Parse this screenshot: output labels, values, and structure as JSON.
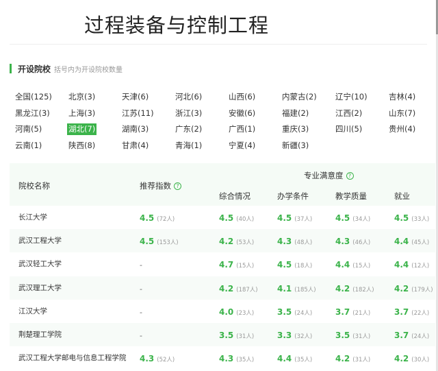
{
  "page": {
    "title": "过程装备与控制工程"
  },
  "section": {
    "title": "开设院校",
    "subtitle": "括号内为开设院校数量"
  },
  "regions": [
    {
      "label": "全国(125)",
      "active": false
    },
    {
      "label": "北京(3)",
      "active": false
    },
    {
      "label": "天津(6)",
      "active": false
    },
    {
      "label": "河北(6)",
      "active": false
    },
    {
      "label": "山西(6)",
      "active": false
    },
    {
      "label": "内蒙古(2)",
      "active": false
    },
    {
      "label": "辽宁(10)",
      "active": false
    },
    {
      "label": "吉林(4)",
      "active": false
    },
    {
      "label": "黑龙江(3)",
      "active": false
    },
    {
      "label": "上海(3)",
      "active": false
    },
    {
      "label": "江苏(11)",
      "active": false
    },
    {
      "label": "浙江(3)",
      "active": false
    },
    {
      "label": "安徽(6)",
      "active": false
    },
    {
      "label": "福建(2)",
      "active": false
    },
    {
      "label": "江西(2)",
      "active": false
    },
    {
      "label": "山东(7)",
      "active": false
    },
    {
      "label": "河南(5)",
      "active": false
    },
    {
      "label": "湖北(7)",
      "active": true
    },
    {
      "label": "湖南(3)",
      "active": false
    },
    {
      "label": "广东(2)",
      "active": false
    },
    {
      "label": "广西(1)",
      "active": false
    },
    {
      "label": "重庆(3)",
      "active": false
    },
    {
      "label": "四川(5)",
      "active": false
    },
    {
      "label": "贵州(4)",
      "active": false
    },
    {
      "label": "云南(1)",
      "active": false
    },
    {
      "label": "陕西(8)",
      "active": false
    },
    {
      "label": "甘肃(4)",
      "active": false
    },
    {
      "label": "青海(1)",
      "active": false
    },
    {
      "label": "宁夏(4)",
      "active": false
    },
    {
      "label": "新疆(3)",
      "active": false
    }
  ],
  "table": {
    "headers": {
      "school": "院校名称",
      "recommend": "推荐指数",
      "satisfaction": "专业满意度",
      "overall": "综合情况",
      "conditions": "办学条件",
      "teaching": "教学质量",
      "employment": "就业"
    },
    "rows": [
      {
        "name": "长江大学",
        "rec": "4.5",
        "rec_n": "(72人)",
        "s1": "4.5",
        "n1": "(40人)",
        "s2": "4.5",
        "n2": "(37人)",
        "s3": "4.5",
        "n3": "(34人)",
        "s4": "4.5",
        "n4": "(33人)"
      },
      {
        "name": "武汉工程大学",
        "rec": "4.5",
        "rec_n": "(153人)",
        "s1": "4.2",
        "n1": "(53人)",
        "s2": "4.3",
        "n2": "(48人)",
        "s3": "4.3",
        "n3": "(46人)",
        "s4": "4.4",
        "n4": "(45人)"
      },
      {
        "name": "武汉轻工大学",
        "rec": "-",
        "rec_n": "",
        "s1": "4.7",
        "n1": "(15人)",
        "s2": "4.5",
        "n2": "(18人)",
        "s3": "4.4",
        "n3": "(15人)",
        "s4": "4.4",
        "n4": "(12人)"
      },
      {
        "name": "武汉理工大学",
        "rec": "-",
        "rec_n": "",
        "s1": "4.2",
        "n1": "(187人)",
        "s2": "4.1",
        "n2": "(185人)",
        "s3": "4.2",
        "n3": "(182人)",
        "s4": "4.2",
        "n4": "(179人)"
      },
      {
        "name": "江汉大学",
        "rec": "-",
        "rec_n": "",
        "s1": "4.0",
        "n1": "(23人)",
        "s2": "3.5",
        "n2": "(24人)",
        "s3": "3.7",
        "n3": "(21人)",
        "s4": "3.7",
        "n4": "(22人)"
      },
      {
        "name": "荆楚理工学院",
        "rec": "-",
        "rec_n": "",
        "s1": "3.5",
        "n1": "(31人)",
        "s2": "3.3",
        "n2": "(32人)",
        "s3": "3.5",
        "n3": "(31人)",
        "s4": "3.7",
        "n4": "(24人)"
      },
      {
        "name": "武汉工程大学邮电与信息工程学院",
        "rec": "4.3",
        "rec_n": "(52人)",
        "s1": "4.3",
        "n1": "(35人)",
        "s2": "4.4",
        "n2": "(35人)",
        "s3": "4.2",
        "n3": "(31人)",
        "s4": "4.2",
        "n4": "(30人)"
      }
    ]
  },
  "colors": {
    "accent": "#3bb34a",
    "header_bg": "#f5fbf6"
  }
}
